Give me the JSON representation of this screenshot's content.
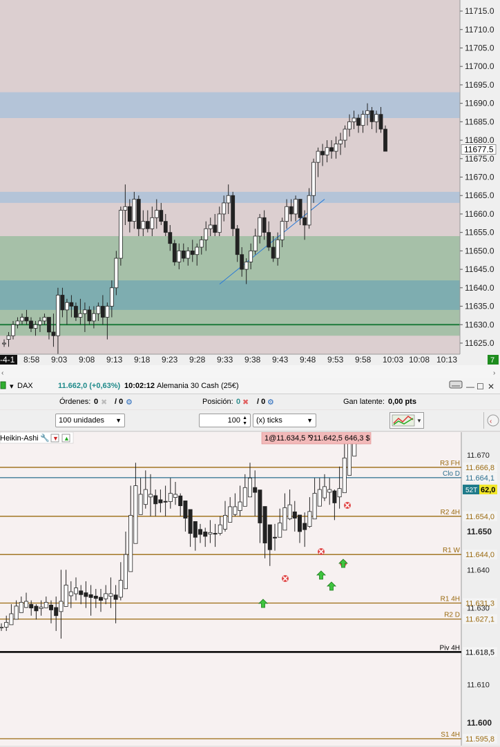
{
  "top_chart": {
    "price_labels": [
      "11715.0",
      "11710.0",
      "11705.0",
      "11700.0",
      "11695.0",
      "11690.0",
      "11685.0",
      "11680.0",
      "11675.0",
      "11670.0",
      "11665.0",
      "11660.0",
      "11655.0",
      "11650.0",
      "11645.0",
      "11640.0",
      "11635.0",
      "11630.0",
      "11625.0"
    ],
    "price_values": [
      11715,
      11710,
      11705,
      11700,
      11695,
      11690,
      11685,
      11680,
      11675,
      11670,
      11665,
      11660,
      11655,
      11650,
      11645,
      11640,
      11635,
      11630,
      11625
    ],
    "current_price": "11677.5",
    "time_labels": [
      "-4-1",
      "8:58",
      "9:03",
      "9:08",
      "9:13",
      "9:18",
      "9:23",
      "9:28",
      "9:33",
      "9:38",
      "9:43",
      "9:48",
      "9:53",
      "9:58",
      "10:03",
      "10:08",
      "10:13"
    ],
    "corner_badge": "7",
    "colors": {
      "blue_zone": "#b4c4d8",
      "green_zone": "#a6c0a8",
      "teal_zone": "#7eadb0",
      "support_line": "#1c7a3a",
      "trendline": "#2a7ad6"
    }
  },
  "chart_data": {
    "type": "candlestick",
    "y_range": [
      11622,
      11718
    ],
    "times": [
      "8:58",
      "9:03",
      "9:08",
      "9:13",
      "9:18",
      "9:23",
      "9:28",
      "9:33",
      "9:38",
      "9:43",
      "9:48",
      "9:53",
      "9:58",
      "10:03"
    ],
    "zones": [
      {
        "from": 11686,
        "to": 11693
      },
      {
        "from": 11663,
        "to": 11666
      },
      {
        "from": 11627,
        "to": 11654
      },
      {
        "from": 11634,
        "to": 11642
      }
    ],
    "horizontal_line": 11630,
    "trendline": [
      [
        11641,
        11664
      ]
    ],
    "candles": [
      [
        11625,
        11626,
        11624,
        11625
      ],
      [
        11626,
        11628,
        11624,
        11627
      ],
      [
        11627,
        11631,
        11626,
        11630
      ],
      [
        11630,
        11632,
        11629,
        11631
      ],
      [
        11631,
        11633,
        11630,
        11632
      ],
      [
        11632,
        11634,
        11630,
        11631
      ],
      [
        11631,
        11632,
        11628,
        11629
      ],
      [
        11629,
        11631,
        11627,
        11630
      ],
      [
        11630,
        11632,
        11628,
        11631
      ],
      [
        11631,
        11633,
        11630,
        11632
      ],
      [
        11632,
        11632,
        11626,
        11628
      ],
      [
        11628,
        11633,
        11624,
        11627
      ],
      [
        11627,
        11640,
        11622,
        11638
      ],
      [
        11638,
        11640,
        11632,
        11634
      ],
      [
        11634,
        11637,
        11630,
        11636
      ],
      [
        11636,
        11638,
        11632,
        11635
      ],
      [
        11635,
        11636,
        11631,
        11632
      ],
      [
        11632,
        11637,
        11630,
        11633
      ],
      [
        11633,
        11636,
        11628,
        11634
      ],
      [
        11634,
        11635,
        11630,
        11631
      ],
      [
        11631,
        11635,
        11629,
        11633
      ],
      [
        11633,
        11636,
        11631,
        11635
      ],
      [
        11635,
        11638,
        11630,
        11632
      ],
      [
        11632,
        11636,
        11626,
        11635
      ],
      [
        11635,
        11642,
        11632,
        11640
      ],
      [
        11640,
        11650,
        11638,
        11648
      ],
      [
        11648,
        11662,
        11646,
        11661
      ],
      [
        11661,
        11668,
        11657,
        11662
      ],
      [
        11662,
        11664,
        11655,
        11658
      ],
      [
        11658,
        11666,
        11656,
        11664
      ],
      [
        11664,
        11665,
        11654,
        11656
      ],
      [
        11656,
        11661,
        11654,
        11658
      ],
      [
        11658,
        11661,
        11655,
        11656
      ],
      [
        11656,
        11662,
        11654,
        11659
      ],
      [
        11659,
        11664,
        11656,
        11661
      ],
      [
        11661,
        11663,
        11657,
        11658
      ],
      [
        11658,
        11660,
        11654,
        11655
      ],
      [
        11655,
        11657,
        11650,
        11652
      ],
      [
        11652,
        11653,
        11646,
        11647
      ],
      [
        11647,
        11652,
        11645,
        11650
      ],
      [
        11650,
        11652,
        11647,
        11648
      ],
      [
        11648,
        11651,
        11646,
        11650
      ],
      [
        11650,
        11653,
        11647,
        11649
      ],
      [
        11649,
        11652,
        11646,
        11651
      ],
      [
        11651,
        11654,
        11649,
        11653
      ],
      [
        11653,
        11658,
        11650,
        11656
      ],
      [
        11656,
        11659,
        11654,
        11657
      ],
      [
        11657,
        11660,
        11654,
        11655
      ],
      [
        11655,
        11662,
        11654,
        11660
      ],
      [
        11660,
        11665,
        11658,
        11663
      ],
      [
        11663,
        11668,
        11660,
        11665
      ],
      [
        11665,
        11666,
        11654,
        11656
      ],
      [
        11656,
        11657,
        11647,
        11649
      ],
      [
        11649,
        11651,
        11643,
        11645
      ],
      [
        11645,
        11648,
        11641,
        11647
      ],
      [
        11647,
        11652,
        11645,
        11650
      ],
      [
        11650,
        11656,
        11649,
        11654
      ],
      [
        11654,
        11660,
        11652,
        11659
      ],
      [
        11659,
        11661,
        11653,
        11655
      ],
      [
        11655,
        11658,
        11650,
        11651
      ],
      [
        11651,
        11654,
        11647,
        11648
      ],
      [
        11648,
        11655,
        11646,
        11653
      ],
      [
        11653,
        11659,
        11651,
        11658
      ],
      [
        11658,
        11664,
        11656,
        11662
      ],
      [
        11662,
        11664,
        11658,
        11660
      ],
      [
        11660,
        11665,
        11658,
        11664
      ],
      [
        11664,
        11664,
        11657,
        11659
      ],
      [
        11659,
        11661,
        11653,
        11657
      ],
      [
        11657,
        11667,
        11656,
        11665
      ],
      [
        11665,
        11675,
        11663,
        11674
      ],
      [
        11674,
        11678,
        11670,
        11677
      ],
      [
        11677,
        11679,
        11673,
        11676
      ],
      [
        11676,
        11680,
        11674,
        11678
      ],
      [
        11678,
        11680,
        11675,
        11677
      ],
      [
        11677,
        11681,
        11675,
        11679
      ],
      [
        11679,
        11682,
        11676,
        11680
      ],
      [
        11680,
        11684,
        11678,
        11683
      ],
      [
        11683,
        11687,
        11681,
        11685
      ],
      [
        11685,
        11688,
        11683,
        11686
      ],
      [
        11686,
        11687,
        11682,
        11684
      ],
      [
        11684,
        11688,
        11682,
        11687
      ],
      [
        11687,
        11690,
        11684,
        11688
      ],
      [
        11688,
        11689,
        11683,
        11685
      ],
      [
        11685,
        11688,
        11682,
        11687
      ],
      [
        11687,
        11689,
        11682,
        11683
      ],
      [
        11683,
        11684,
        11677,
        11677
      ]
    ]
  },
  "toolbar": {
    "instrument": "DAX",
    "price_change": "11.662,0 (+0,63%)",
    "time": "10:02:12",
    "instrument_name": "Alemania 30 Cash (25€)",
    "orders_label": "Órdenes:",
    "orders_value": "0",
    "orders_slash": "/ 0",
    "position_label": "Posición:",
    "position_value": "0",
    "position_slash": "/ 0",
    "pnl_label": "Gan latente:",
    "pnl_value": "0,00 pts",
    "qty_select": "100 unidades",
    "ticks_value": "100",
    "ticks_unit": "(x) ticks"
  },
  "bottom_chart": {
    "indicator": "Heikin-Ashi",
    "order_info": "1@11.634,5 ⅋11.642,5 646,3 $",
    "levels": [
      {
        "label": "R3 FH",
        "value": "11.666,8",
        "color": "#9a6a10"
      },
      {
        "label": "Clo D",
        "value": "11.664,1",
        "color": "#2a6e8e"
      },
      {
        "label": "R2 4H",
        "value": "11.654,0",
        "color": "#9a6a10"
      },
      {
        "label": "R1 W",
        "value": "11.644,0",
        "color": "#9a6a10"
      },
      {
        "label": "R1 4H",
        "value": "11.631,3",
        "color": "#9a6a10"
      },
      {
        "label": "R2 D",
        "value": "11.627,1",
        "color": "#9a6a10"
      },
      {
        "label": "Piv 4H",
        "value": "11.618,5",
        "color": "#000000"
      },
      {
        "label": "S1 4H",
        "value": "11.595,8",
        "color": "#9a6a10"
      }
    ],
    "axis_labels": [
      "11.670",
      "11.650",
      "11.640",
      "11.630",
      "11.610",
      "11.600"
    ],
    "bold_axis_labels": [
      "11.650",
      "11.600"
    ],
    "current_value": "62,0",
    "countdown": "52T",
    "y_range": [
      11594,
      11676
    ]
  }
}
